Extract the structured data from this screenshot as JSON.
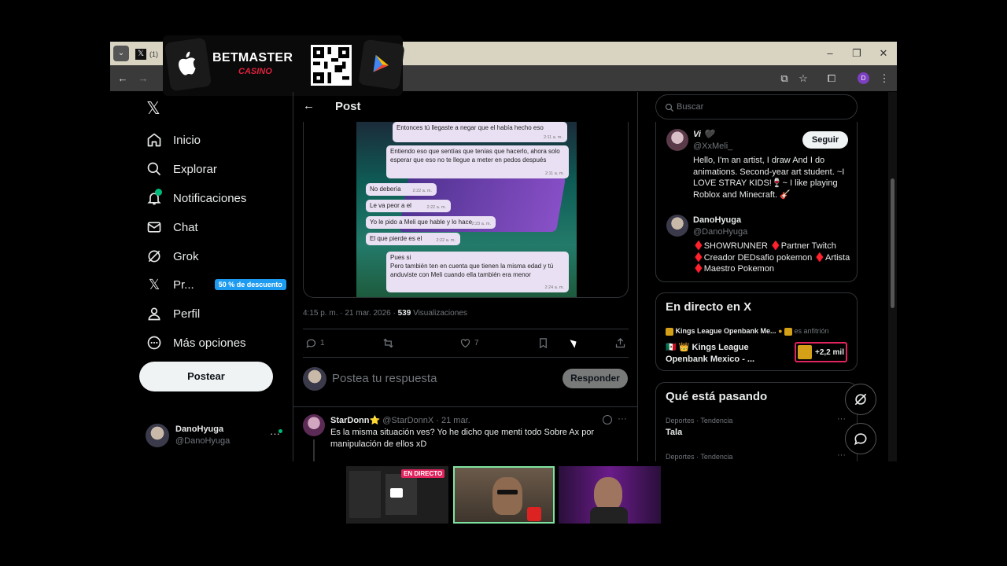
{
  "browser": {
    "tab_count_text": "(1)",
    "profile_initial": "D"
  },
  "ad": {
    "brand": "BETMASTER",
    "sub": "CASINO"
  },
  "sidebar": {
    "items": [
      {
        "label": "Inicio",
        "icon": "home-icon"
      },
      {
        "label": "Explorar",
        "icon": "search-icon"
      },
      {
        "label": "Notificaciones",
        "icon": "bell-icon"
      },
      {
        "label": "Chat",
        "icon": "mail-icon"
      },
      {
        "label": "Grok",
        "icon": "grok-icon"
      },
      {
        "label": "Pr...",
        "icon": "x-premium-icon"
      },
      {
        "label": "Perfil",
        "icon": "person-icon"
      },
      {
        "label": "Más opciones",
        "icon": "more-circle-icon"
      }
    ],
    "premium_badge": "50 % de descuento",
    "post_button": "Postear",
    "account_name": "DanoHyuga",
    "account_handle": "@DanoHyuga"
  },
  "main": {
    "header_title": "Post",
    "chat": [
      {
        "text": "Entonces tú llegaste a negar que el había hecho eso",
        "time": "2:11 a. m."
      },
      {
        "text": "Entiendo eso que sentías que tenías que hacerlo, ahora solo esperar que eso no te llegue a meter en pedos después",
        "time": "2:11 a. m."
      },
      {
        "text": "No debería",
        "time": "2:22 a. m."
      },
      {
        "text": "Le va peor a el",
        "time": "2:22 a. m."
      },
      {
        "text": "Yo le pido a Meli que hable y lo hace",
        "time": "2:23 a. m."
      },
      {
        "text": "El que pierde es el",
        "time": "2:22 a. m."
      },
      {
        "text": "Pues si\nPero también ten en cuenta que tienen la misma edad y tú anduviste con Meli cuando ella también era menor",
        "time": "2:24 a. m."
      }
    ],
    "meta_time": "4:15 p. m. · 21 mar. 2026 · ",
    "meta_views_count": "539",
    "meta_views_label": " Visualizaciones",
    "replies": "1",
    "likes": "7",
    "reply_placeholder": "Postea tu respuesta",
    "reply_button": "Responder",
    "comment": {
      "name": "StarDonn⭐",
      "handle": "@StarDonnX · 21 mar.",
      "text": "Es la misma situación ves? Yo he dicho que menti todo Sobre Ax por manipulación de ellos xD"
    }
  },
  "right": {
    "search_placeholder": "Buscar",
    "profile1": {
      "name": "Vi 🖤",
      "handle": "@XxMeli_",
      "follow": "Seguir",
      "bio": "Hello, I'm an artist, I draw And I do animations. Second-year art student. ~I LOVE STRAY KIDS!🍷~ I like playing Roblox and Minecraft. 🎸"
    },
    "profile2": {
      "name": "DanoHyuga",
      "handle": "@DanoHyuga",
      "bio": "♦️SHOWRUNNER ♦️Partner Twitch ♦️Creador DEDsafio pokemon ♦️Artista ♦️Maestro Pokemon"
    },
    "live": {
      "title": "En directo en X",
      "host": "Kings League Openbank Me...",
      "host_suffix": "es anfitrión",
      "event": "🇲🇽 👑 Kings League Openbank Mexico - ...",
      "count": "+2,2 mil"
    },
    "trending": {
      "title": "Qué está pasando",
      "items": [
        {
          "category": "Deportes · Tendencia",
          "name": "Tala"
        },
        {
          "category": "Deportes · Tendencia",
          "name": ""
        }
      ]
    }
  },
  "stream": {
    "live_badge": "EN DIRECTO"
  }
}
